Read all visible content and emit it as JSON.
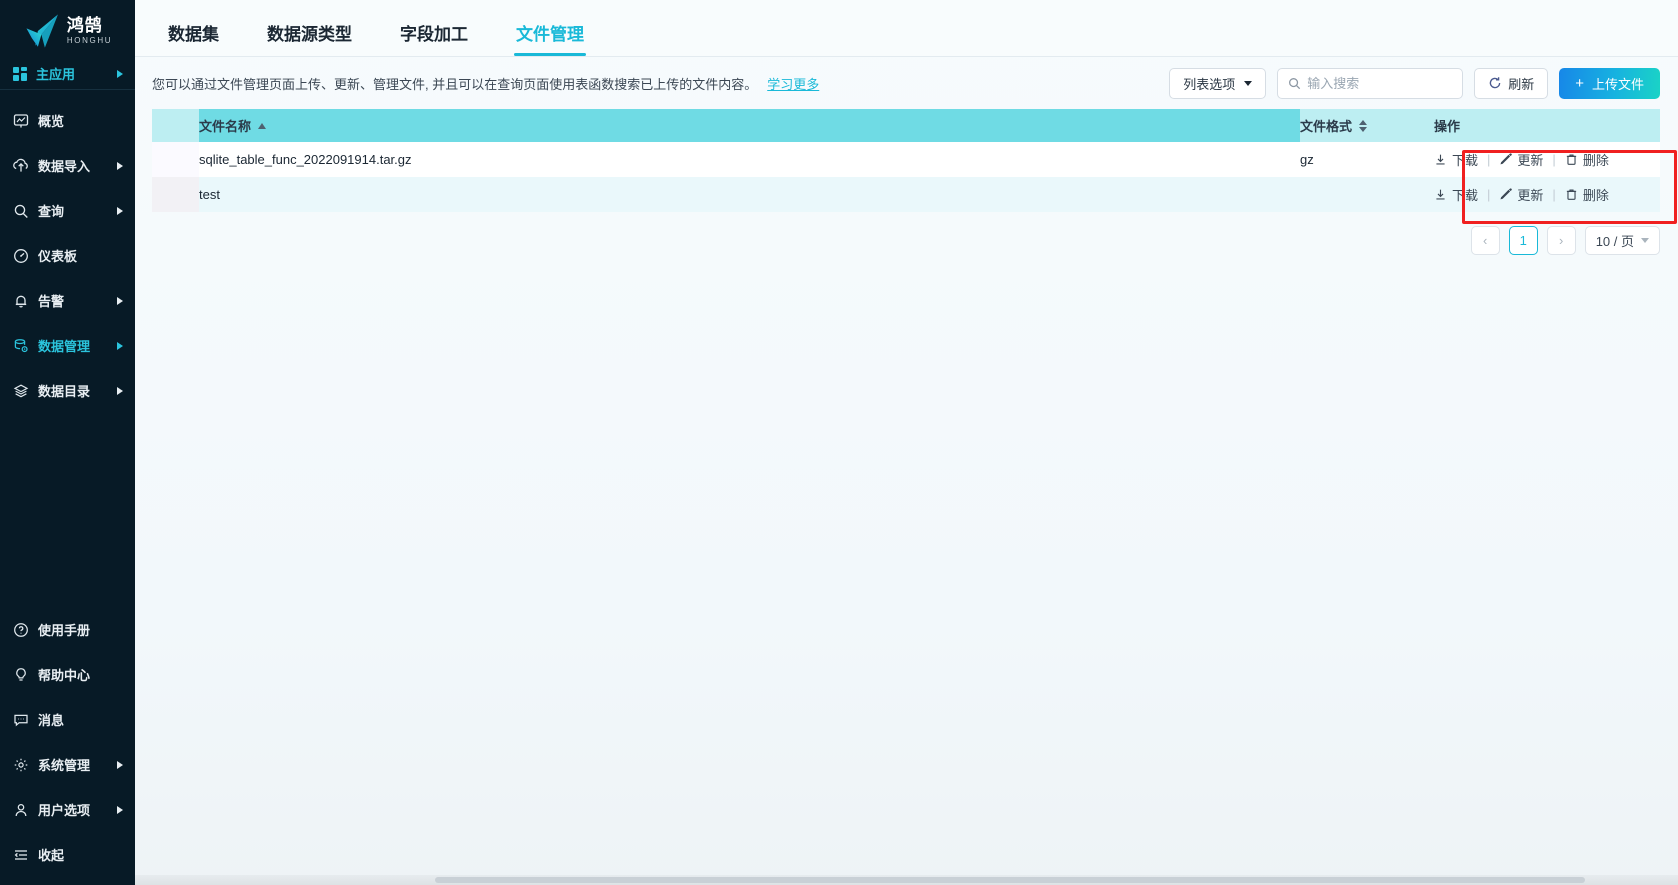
{
  "brand": {
    "name_cn": "鸿鹄",
    "name_en": "HONGHU",
    "accent": "#19b9d8",
    "sidebar_bg": "#071a26"
  },
  "sidebar": {
    "main_app": {
      "label": "主应用",
      "icon": "apps-grid-icon",
      "has_arrow": true,
      "active": true
    },
    "items": [
      {
        "label": "概览",
        "icon": "overview-icon",
        "has_arrow": false,
        "active": false
      },
      {
        "label": "数据导入",
        "icon": "data-import-icon",
        "has_arrow": true,
        "active": false
      },
      {
        "label": "查询",
        "icon": "search-icon",
        "has_arrow": true,
        "active": false
      },
      {
        "label": "仪表板",
        "icon": "dashboard-icon",
        "has_arrow": false,
        "active": false
      },
      {
        "label": "告警",
        "icon": "bell-icon",
        "has_arrow": true,
        "active": false
      },
      {
        "label": "数据管理",
        "icon": "database-gear-icon",
        "has_arrow": true,
        "active": true
      },
      {
        "label": "数据目录",
        "icon": "layers-icon",
        "has_arrow": true,
        "active": false
      }
    ],
    "bottom_items": [
      {
        "label": "使用手册",
        "icon": "question-circle-icon",
        "has_arrow": false
      },
      {
        "label": "帮助中心",
        "icon": "lightbulb-icon",
        "has_arrow": false
      },
      {
        "label": "消息",
        "icon": "message-icon",
        "has_arrow": false
      },
      {
        "label": "系统管理",
        "icon": "gear-icon",
        "has_arrow": true
      },
      {
        "label": "用户选项",
        "icon": "user-icon",
        "has_arrow": true
      },
      {
        "label": "收起",
        "icon": "collapse-icon",
        "has_arrow": false
      }
    ]
  },
  "tabs": [
    {
      "label": "数据集",
      "active": false
    },
    {
      "label": "数据源类型",
      "active": false
    },
    {
      "label": "字段加工",
      "active": false
    },
    {
      "label": "文件管理",
      "active": true
    }
  ],
  "toolbar": {
    "description": "您可以通过文件管理页面上传、更新、管理文件, 并且可以在查询页面使用表函数搜索已上传的文件内容。",
    "learn_more": "学习更多",
    "list_options_label": "列表选项",
    "search_placeholder": "输入搜索",
    "search_value": "",
    "refresh_label": "刷新",
    "upload_label": "上传文件",
    "upload_plus": "+"
  },
  "table": {
    "columns": [
      {
        "label": "文件名称",
        "sort": "asc",
        "key": "name"
      },
      {
        "label": "文件格式",
        "sort": "both",
        "key": "format"
      },
      {
        "label": "操作",
        "sort": "none",
        "key": "actions"
      }
    ],
    "rows": [
      {
        "name": "sqlite_table_func_2022091914.tar.gz",
        "format": "gz"
      },
      {
        "name": "test",
        "format": ""
      }
    ],
    "row_actions": [
      {
        "label": "下载",
        "icon": "download-icon"
      },
      {
        "label": "更新",
        "icon": "edit-pencil-icon"
      },
      {
        "label": "删除",
        "icon": "trash-icon"
      }
    ],
    "action_separator": "|"
  },
  "highlight": {
    "color": "#f02020"
  },
  "pagination": {
    "prev": "‹",
    "next": "›",
    "pages": [
      "1"
    ],
    "current_page": "1",
    "page_size_label": "10 / 页"
  }
}
